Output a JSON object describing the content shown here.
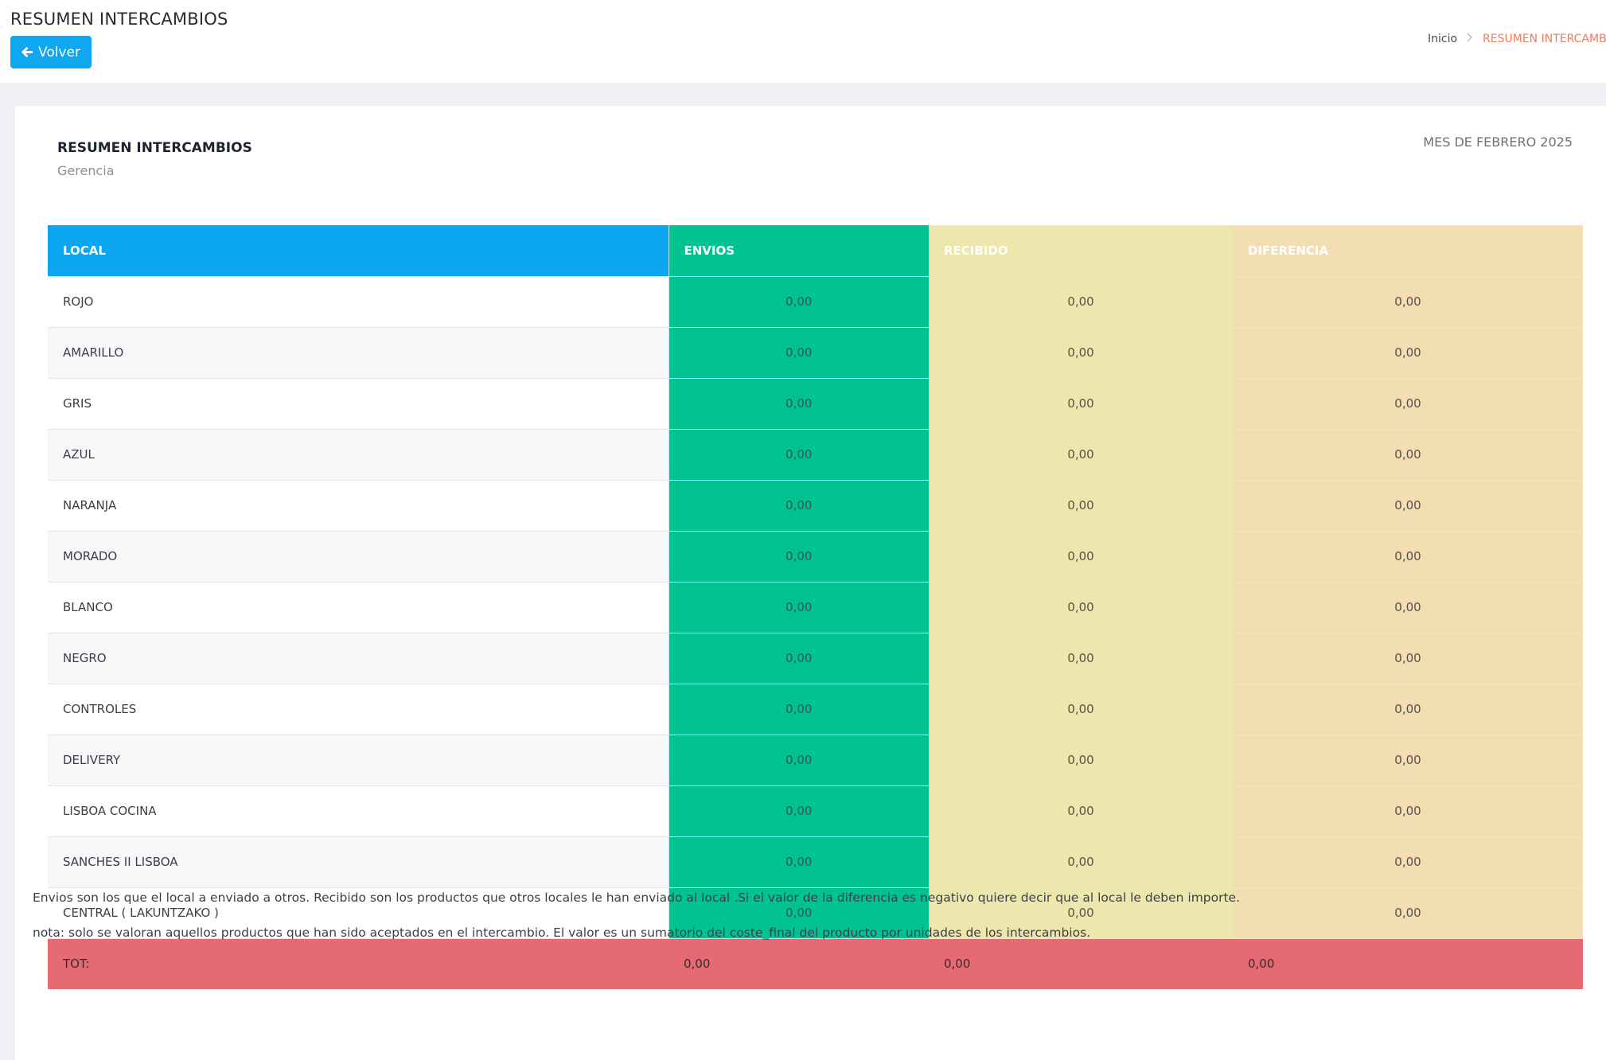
{
  "header": {
    "title": "RESUMEN INTERCAMBIOS",
    "back_label": "Volver",
    "breadcrumb": {
      "home": "Inicio",
      "current": "RESUMEN INTERCAMBIOS"
    }
  },
  "card": {
    "title": "RESUMEN INTERCAMBIOS",
    "subtitle": "Gerencia",
    "period": "MES DE FEBRERO 2025"
  },
  "table": {
    "columns": {
      "local": "LOCAL",
      "envios": "ENVIOS",
      "recibido": "RECIBIDO",
      "diferencia": "DIFERENCIA"
    },
    "rows": [
      {
        "local": "ROJO",
        "envios": "0,00",
        "recibido": "0,00",
        "diferencia": "0,00"
      },
      {
        "local": "AMARILLO",
        "envios": "0,00",
        "recibido": "0,00",
        "diferencia": "0,00"
      },
      {
        "local": "GRIS",
        "envios": "0,00",
        "recibido": "0,00",
        "diferencia": "0,00"
      },
      {
        "local": "AZUL",
        "envios": "0,00",
        "recibido": "0,00",
        "diferencia": "0,00"
      },
      {
        "local": "NARANJA",
        "envios": "0,00",
        "recibido": "0,00",
        "diferencia": "0,00"
      },
      {
        "local": "MORADO",
        "envios": "0,00",
        "recibido": "0,00",
        "diferencia": "0,00"
      },
      {
        "local": "BLANCO",
        "envios": "0,00",
        "recibido": "0,00",
        "diferencia": "0,00"
      },
      {
        "local": "NEGRO",
        "envios": "0,00",
        "recibido": "0,00",
        "diferencia": "0,00"
      },
      {
        "local": "CONTROLES",
        "envios": "0,00",
        "recibido": "0,00",
        "diferencia": "0,00"
      },
      {
        "local": "DELIVERY",
        "envios": "0,00",
        "recibido": "0,00",
        "diferencia": "0,00"
      },
      {
        "local": "LISBOA COCINA",
        "envios": "0,00",
        "recibido": "0,00",
        "diferencia": "0,00"
      },
      {
        "local": "SANCHES II LISBOA",
        "envios": "0,00",
        "recibido": "0,00",
        "diferencia": "0,00"
      },
      {
        "local": "CENTRAL ( LAKUNTZAKO )",
        "envios": "0,00",
        "recibido": "0,00",
        "diferencia": "0,00"
      }
    ],
    "total": {
      "label": "TOT:",
      "envios": "0,00",
      "recibido": "0,00",
      "diferencia": "0,00"
    }
  },
  "notes": [
    "Envios son los que el local a enviado a otros. Recibido son los productos que otros locales le han enviado al local .Si el valor de la diferencia es negativo quiere decir que al local le deben importe.",
    "nota: solo se valoran aquellos productos que han sido aceptados en el intercambio. El valor es un sumatorio del coste_final del producto por unidades de los intercambios."
  ],
  "icons": {
    "back": "arrow-left-icon",
    "breadcrumb_separator": "chevron-right-icon"
  },
  "colors": {
    "primary": "#0ba6ef",
    "envios": "#01c293",
    "recibido": "#ede7ad",
    "diferencia": "#f3deb4",
    "total_row": "#e56a73",
    "breadcrumb_active": "#f07b5a"
  }
}
